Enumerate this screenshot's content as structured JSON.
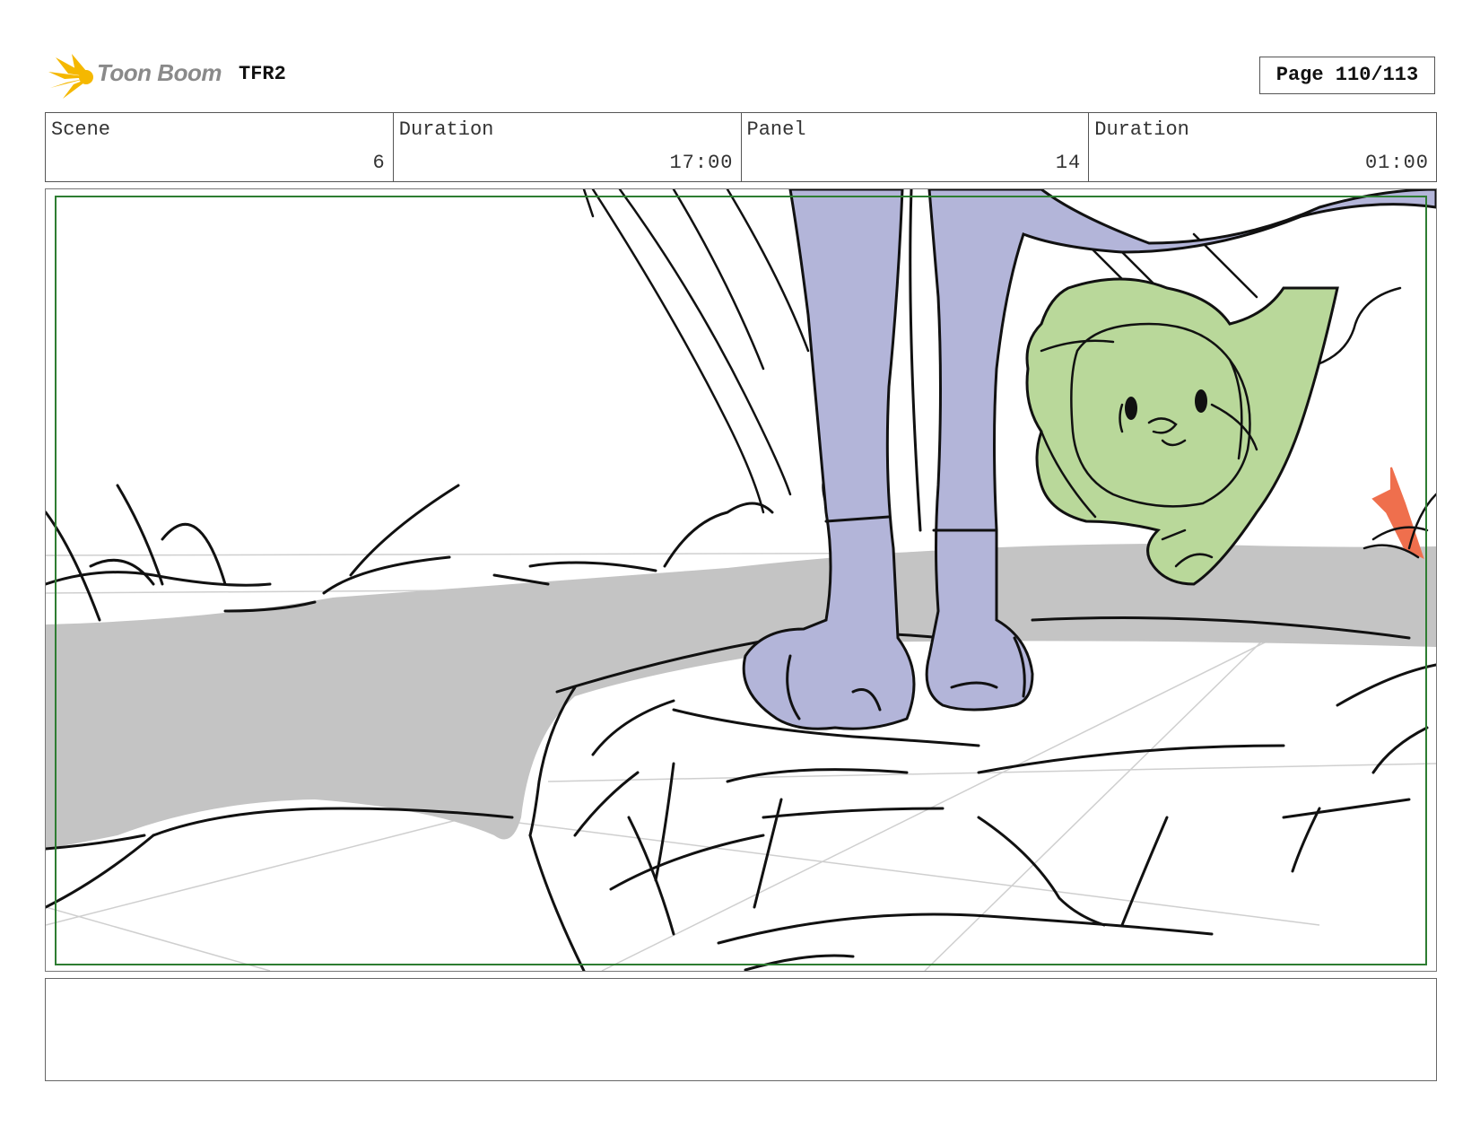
{
  "header": {
    "brand": "Toon Boom",
    "project": "TFR2",
    "page_label": "Page 110/113"
  },
  "info": [
    {
      "label": "Scene",
      "value": "6"
    },
    {
      "label": "Duration",
      "value": "17:00"
    },
    {
      "label": "Panel",
      "value": "14"
    },
    {
      "label": "Duration",
      "value": "01:00"
    }
  ],
  "colors": {
    "logo_flare": "#f5b800",
    "safe_area": "#2e7d32",
    "character_purple": "#b3b5d9",
    "character_green": "#b9d89a",
    "ground_gray": "#c4c4c4",
    "accent_orange": "#ef6f4d"
  },
  "notes": ""
}
